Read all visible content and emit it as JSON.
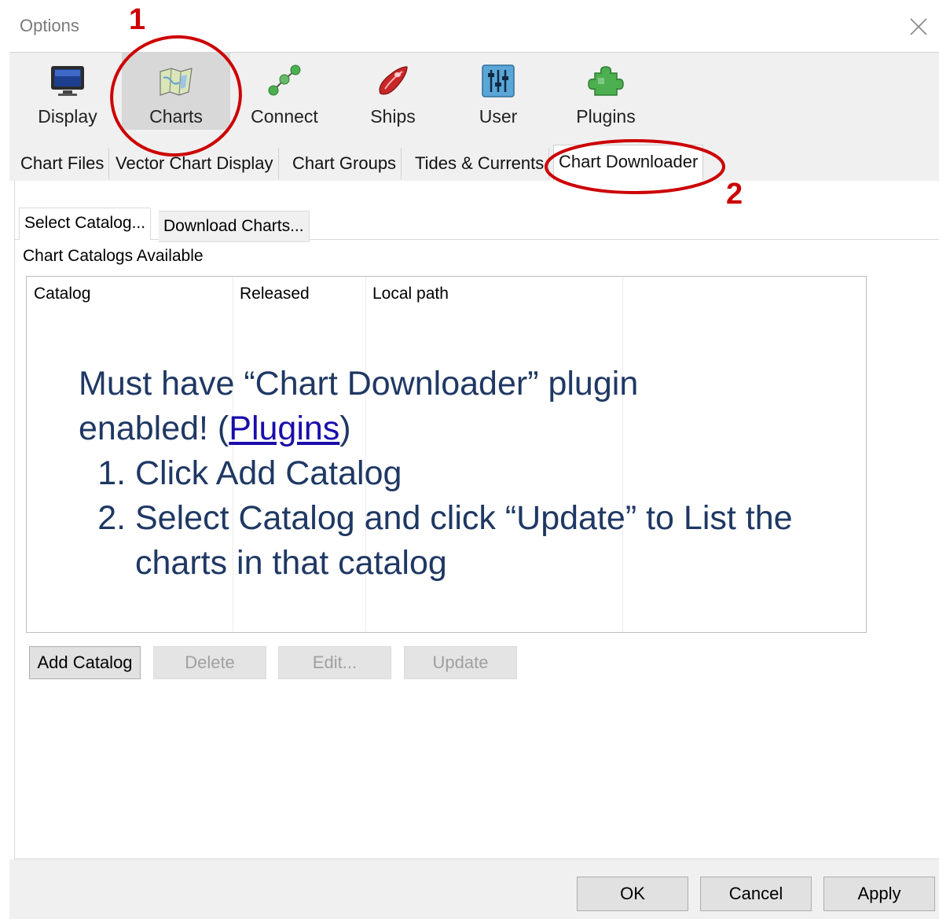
{
  "window": {
    "title": "Options"
  },
  "toolbar": {
    "items": [
      {
        "label": "Display",
        "icon": "display-icon"
      },
      {
        "label": "Charts",
        "icon": "charts-icon"
      },
      {
        "label": "Connect",
        "icon": "connect-icon"
      },
      {
        "label": "Ships",
        "icon": "ships-icon"
      },
      {
        "label": "User",
        "icon": "user-icon"
      },
      {
        "label": "Plugins",
        "icon": "plugins-icon"
      }
    ],
    "selected": "Charts"
  },
  "tabs": [
    {
      "label": "Chart Files"
    },
    {
      "label": "Vector Chart Display"
    },
    {
      "label": "Chart Groups"
    },
    {
      "label": "Tides & Currents"
    },
    {
      "label": "Chart Downloader"
    }
  ],
  "subtabs": [
    {
      "label": "Select Catalog..."
    },
    {
      "label": "Download Charts..."
    }
  ],
  "catalogs": {
    "label": "Chart Catalogs Available",
    "columns": [
      "Catalog",
      "Released",
      "Local path"
    ]
  },
  "buttons": {
    "add_catalog": "Add Catalog",
    "delete": "Delete",
    "edit": "Edit...",
    "update": "Update"
  },
  "note": {
    "line1": "Must have “Chart Downloader” plugin",
    "line2_prefix": "enabled! (",
    "line2_link": "Plugins",
    "line2_suffix": ")",
    "steps": [
      "Click Add Catalog",
      "Select Catalog and click “Update” to List the charts in that catalog"
    ]
  },
  "annotations": {
    "marker1": "1",
    "marker2": "2",
    "color": "#cc0000"
  },
  "footer": {
    "ok": "OK",
    "cancel": "Cancel",
    "apply": "Apply"
  }
}
